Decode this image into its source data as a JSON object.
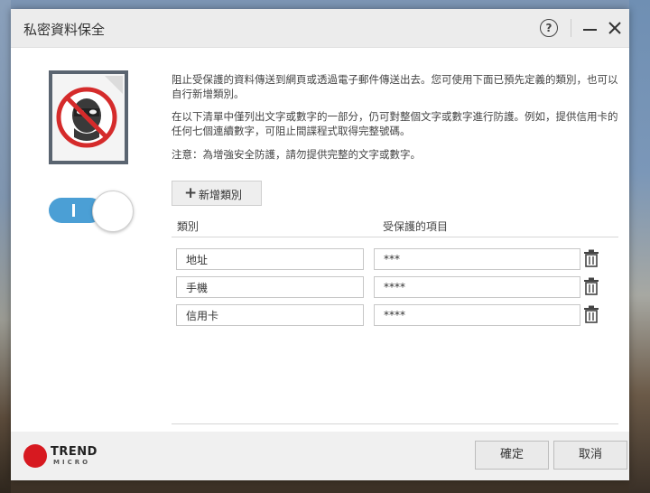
{
  "dialog": {
    "title": "私密資料保全"
  },
  "description": {
    "p1": "阻止受保護的資料傳送到網頁或透過電子郵件傳送出去。您可使用下面已預先定義的類別，也可以自行新增類別。",
    "p2": "在以下清單中僅列出文字或數字的一部分，仍可對整個文字或數字進行防護。例如，提供信用卡的任何七個連續數字，可阻止間諜程式取得完整號碼。",
    "p3": "注意：為增強安全防護，請勿提供完整的文字或數字。"
  },
  "toolbar": {
    "add_label": "新增類別"
  },
  "table": {
    "headers": [
      "類別",
      "受保護的項目"
    ],
    "rows": [
      {
        "category": "地址",
        "item": "***"
      },
      {
        "category": "手機",
        "item": "****"
      },
      {
        "category": "信用卡",
        "item": "****"
      }
    ]
  },
  "buttons": {
    "ok": "確定",
    "cancel": "取消"
  },
  "brand": {
    "name_line1": "TREND",
    "name_line2": "MICRO",
    "color": "#d71920"
  },
  "colors": {
    "toggle_on": "#4b9fd5"
  },
  "icons": {
    "help": "question-mark",
    "minimize": "minimize-line",
    "close": "x-close",
    "delete": "trash-can",
    "add": "plus"
  }
}
